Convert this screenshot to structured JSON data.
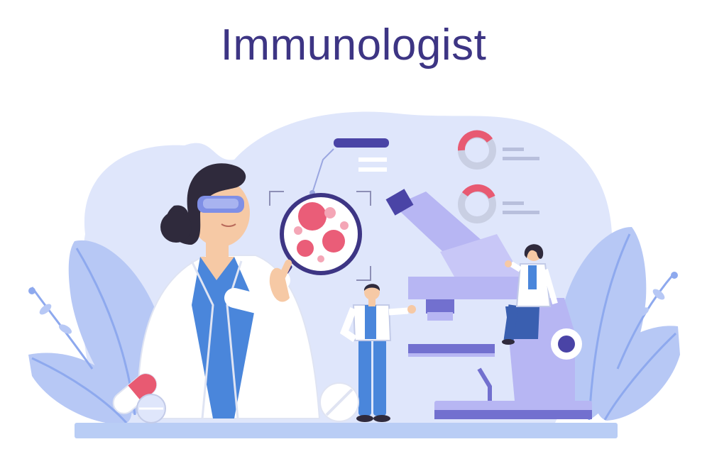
{
  "title": "Immunologist",
  "colors": {
    "title": "#3d3584",
    "blob": "#dfe6fb",
    "leaf": "#b7c8f5",
    "leaf_vein": "#8ea9ee",
    "coat": "#ffffff",
    "shirt": "#4a86db",
    "hair": "#2f2a3c",
    "skin": "#f6c9a5",
    "goggles": "#7f8fe6",
    "cells": "#ea5d78",
    "microscope": "#b7b6f3",
    "microscope_dark": "#7270cf",
    "floor": "#b9cdf5",
    "chart_red": "#e85a72",
    "chart_grey": "#c9cfe3",
    "indigo": "#4a44a6"
  },
  "icons": [
    "magnifier-icon",
    "donut-chart-icon",
    "pill-icon",
    "microscope-icon",
    "plant-icon"
  ]
}
